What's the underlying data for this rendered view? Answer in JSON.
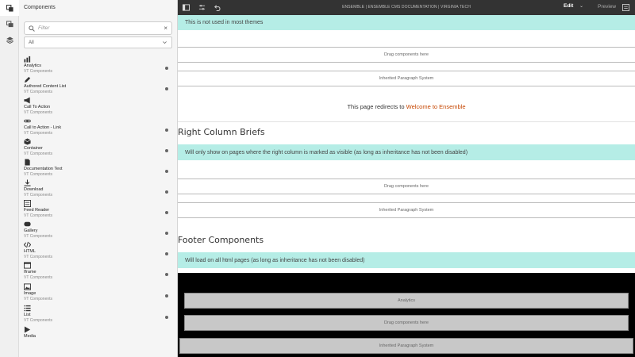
{
  "rail": {
    "buttons": [
      "components-icon",
      "assets-icon",
      "layers-icon"
    ]
  },
  "panel": {
    "title": "Components",
    "filter_placeholder": "Filter",
    "clear_glyph": "×",
    "group_value": "All",
    "components": [
      {
        "name": "Analytics",
        "group": "VT Components",
        "icon": "analytics-icon"
      },
      {
        "name": "Authored Content List",
        "group": "VT Components",
        "icon": "pencil-icon"
      },
      {
        "name": "Call To Action",
        "group": "VT Components",
        "icon": "megaphone-icon"
      },
      {
        "name": "Call to Action - Link",
        "group": "VT Components",
        "icon": "link-icon"
      },
      {
        "name": "Container",
        "group": "VT Components",
        "icon": "box-icon"
      },
      {
        "name": "Documentation Text",
        "group": "VT Components",
        "icon": "document-icon"
      },
      {
        "name": "Download",
        "group": "VT Components",
        "icon": "download-icon"
      },
      {
        "name": "Feed Reader",
        "group": "VT Components",
        "icon": "feed-icon"
      },
      {
        "name": "Gallery",
        "group": "VT Components",
        "icon": "gallery-icon"
      },
      {
        "name": "HTML",
        "group": "VT Components",
        "icon": "code-icon"
      },
      {
        "name": "Iframe",
        "group": "VT Components",
        "icon": "iframe-icon"
      },
      {
        "name": "Image",
        "group": "VT Components",
        "icon": "image-icon"
      },
      {
        "name": "List",
        "group": "VT Components",
        "icon": "list-icon"
      },
      {
        "name": "Media",
        "group": "",
        "icon": "play-icon"
      }
    ]
  },
  "toolbar": {
    "doc_title": "ENSEMBLE | ENSEMBLE CMS DOCUMENTATION | VIRGINIA TECH",
    "edit_label": "Edit",
    "edit_chevron": "⌄",
    "preview_label": "Preview"
  },
  "content": {
    "notes": {
      "not_used": "This is not used in most themes",
      "right_col": "Will only show on pages where the right column is marked as visible (as long as inheritance has not been disabled)",
      "footer": "Will load on all html pages (as long as inheritance has not been disabled)"
    },
    "drag_label": "Drag components here",
    "inherited_label": "Inherited Paragraph System",
    "redirect_prefix": "This page redirects to ",
    "redirect_link": "Welcome to Ensemble",
    "right_heading": "Right Column Briefs",
    "footer_heading": "Footer Components",
    "analytics_label": "Analytics"
  },
  "colors": {
    "note_bg": "#b5ede6",
    "toolbar_bg": "#333333",
    "link": "#c64600",
    "footer_bg": "#000000"
  }
}
